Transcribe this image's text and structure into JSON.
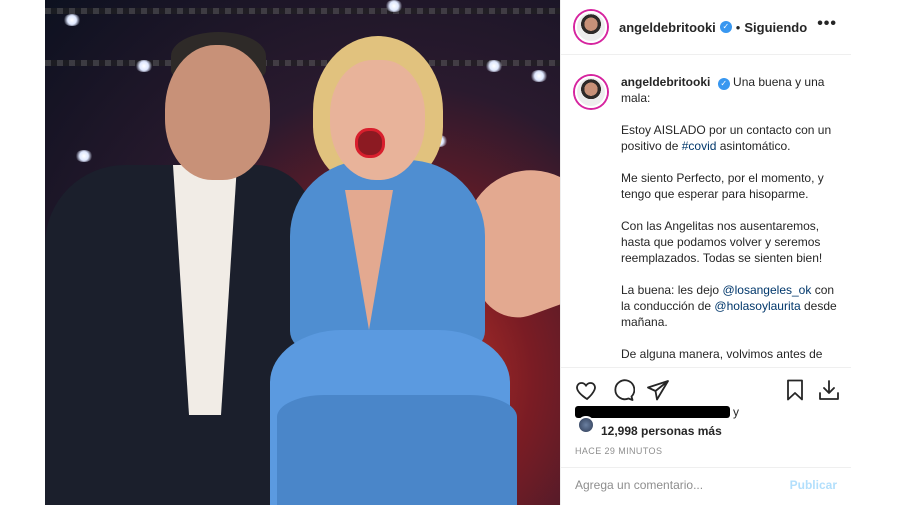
{
  "header": {
    "username": "angeldebritooki",
    "separator": "•",
    "follow_status": "Siguiendo",
    "more_icon": "more-options-icon"
  },
  "caption": {
    "username": "angeldebritooki",
    "p1": "Una buena y una mala:",
    "p2": "Estoy AISLADO por un contacto con un positivo de",
    "p2_tag": "#covid",
    "p2_end": "asintomático.",
    "p3": "Me siento Perfecto, por el momento, y tengo que esperar para hisoparme.",
    "p4": "Con las Angelitas nos ausentaremos, hasta que podamos volver y seremos reemplazados. Todas se sienten bien!",
    "p5_a": "La buena: les dejo",
    "p5_mention1": "@losangeles_ok",
    "p5_b": "con la conducción de",
    "p5_mention2": "@holasoylaurita",
    "p5_c": "desde mañana.",
    "p6": "De alguna manera, volvimos antes de"
  },
  "actions": {
    "icons": [
      "heart-icon",
      "comment-icon",
      "share-icon",
      "bookmark-icon",
      "download-icon"
    ]
  },
  "likes": {
    "suffix": "y",
    "count_text": "12,998 personas más"
  },
  "timestamp": "HACE 29 MINUTOS",
  "comment": {
    "placeholder": "Agrega un comentario...",
    "publish_label": "Publicar"
  },
  "colors": {
    "link": "#00376b",
    "verified": "#3897f0",
    "publish_disabled": "#b2dffc",
    "muted": "#8e8e8e"
  }
}
